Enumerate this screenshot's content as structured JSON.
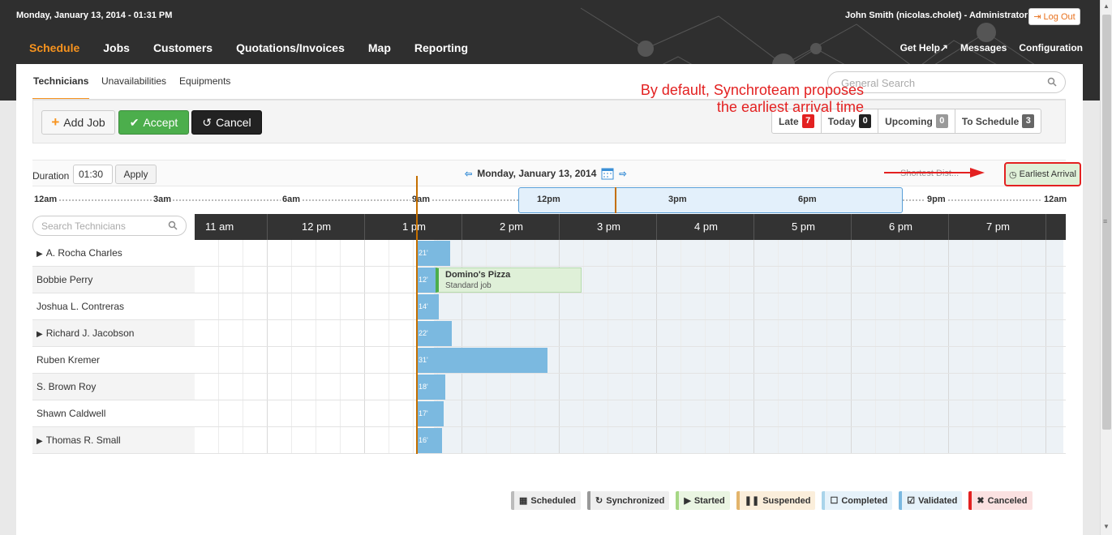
{
  "header": {
    "datetime": "Monday, January 13, 2014 - 01:31 PM",
    "user": "John Smith (nicolas.cholet) - Administrator",
    "logout": "Log Out",
    "nav": [
      "Schedule",
      "Jobs",
      "Customers",
      "Quotations/Invoices",
      "Map",
      "Reporting"
    ],
    "right_nav": [
      "Get Help",
      "Messages",
      "Configuration"
    ]
  },
  "subtabs": [
    "Technicians",
    "Unavailabilities",
    "Equipments"
  ],
  "search": {
    "placeholder": "General Search"
  },
  "toolbar": {
    "add": "Add Job",
    "accept": "Accept",
    "cancel": "Cancel"
  },
  "filters": [
    {
      "label": "Late",
      "count": "7",
      "color": "#e32121"
    },
    {
      "label": "Today",
      "count": "0",
      "color": "#222222"
    },
    {
      "label": "Upcoming",
      "count": "0",
      "color": "#999999"
    },
    {
      "label": "To Schedule",
      "count": "3",
      "color": "#666666"
    }
  ],
  "duration": {
    "label": "Duration",
    "value": "01:30",
    "apply": "Apply"
  },
  "date_nav": {
    "date": "Monday, January 13, 2014"
  },
  "route_options": {
    "shortest": "Shortest Dist...",
    "earliest": "Earliest Arrival"
  },
  "annotation": {
    "line1": "By default, Synchroteam proposes",
    "line2": "the earliest arrival time"
  },
  "ruler_labels": [
    "12am",
    "3am",
    "6am",
    "9am",
    "12pm",
    "3pm",
    "6pm",
    "9pm",
    "12am"
  ],
  "tech_search": {
    "placeholder": "Search Technicians"
  },
  "hours": [
    "11 am",
    "12 pm",
    "1 pm",
    "2 pm",
    "3 pm",
    "4 pm",
    "5 pm",
    "6 pm",
    "7 pm"
  ],
  "technicians": [
    {
      "name": "A. Rocha Charles",
      "expandable": true,
      "travel": "21'"
    },
    {
      "name": "Bobbie Perry",
      "expandable": false,
      "travel": "12'"
    },
    {
      "name": "Joshua L. Contreras",
      "expandable": false,
      "travel": "14'"
    },
    {
      "name": "Richard J. Jacobson",
      "expandable": true,
      "travel": "22'"
    },
    {
      "name": "Ruben Kremer",
      "expandable": false,
      "travel": "31'"
    },
    {
      "name": "S. Brown Roy",
      "expandable": false,
      "travel": "18'"
    },
    {
      "name": "Shawn Caldwell",
      "expandable": false,
      "travel": "17'"
    },
    {
      "name": "Thomas R. Small",
      "expandable": true,
      "travel": "16'"
    }
  ],
  "job": {
    "title": "Domino's Pizza",
    "subtitle": "Standard job"
  },
  "legend": [
    {
      "label": "Scheduled",
      "icon": "calendar-icon",
      "color": "#bbbbbb"
    },
    {
      "label": "Synchronized",
      "icon": "refresh-icon",
      "color": "#999999"
    },
    {
      "label": "Started",
      "icon": "play-icon",
      "color": "#a6d785"
    },
    {
      "label": "Suspended",
      "icon": "pause-icon",
      "color": "#e3b46c"
    },
    {
      "label": "Completed",
      "icon": "empty-box-icon",
      "color": "#a9d4ea"
    },
    {
      "label": "Validated",
      "icon": "checkbox-icon",
      "color": "#7bb9e0"
    },
    {
      "label": "Canceled",
      "icon": "x-icon",
      "color": "#e32121"
    }
  ]
}
